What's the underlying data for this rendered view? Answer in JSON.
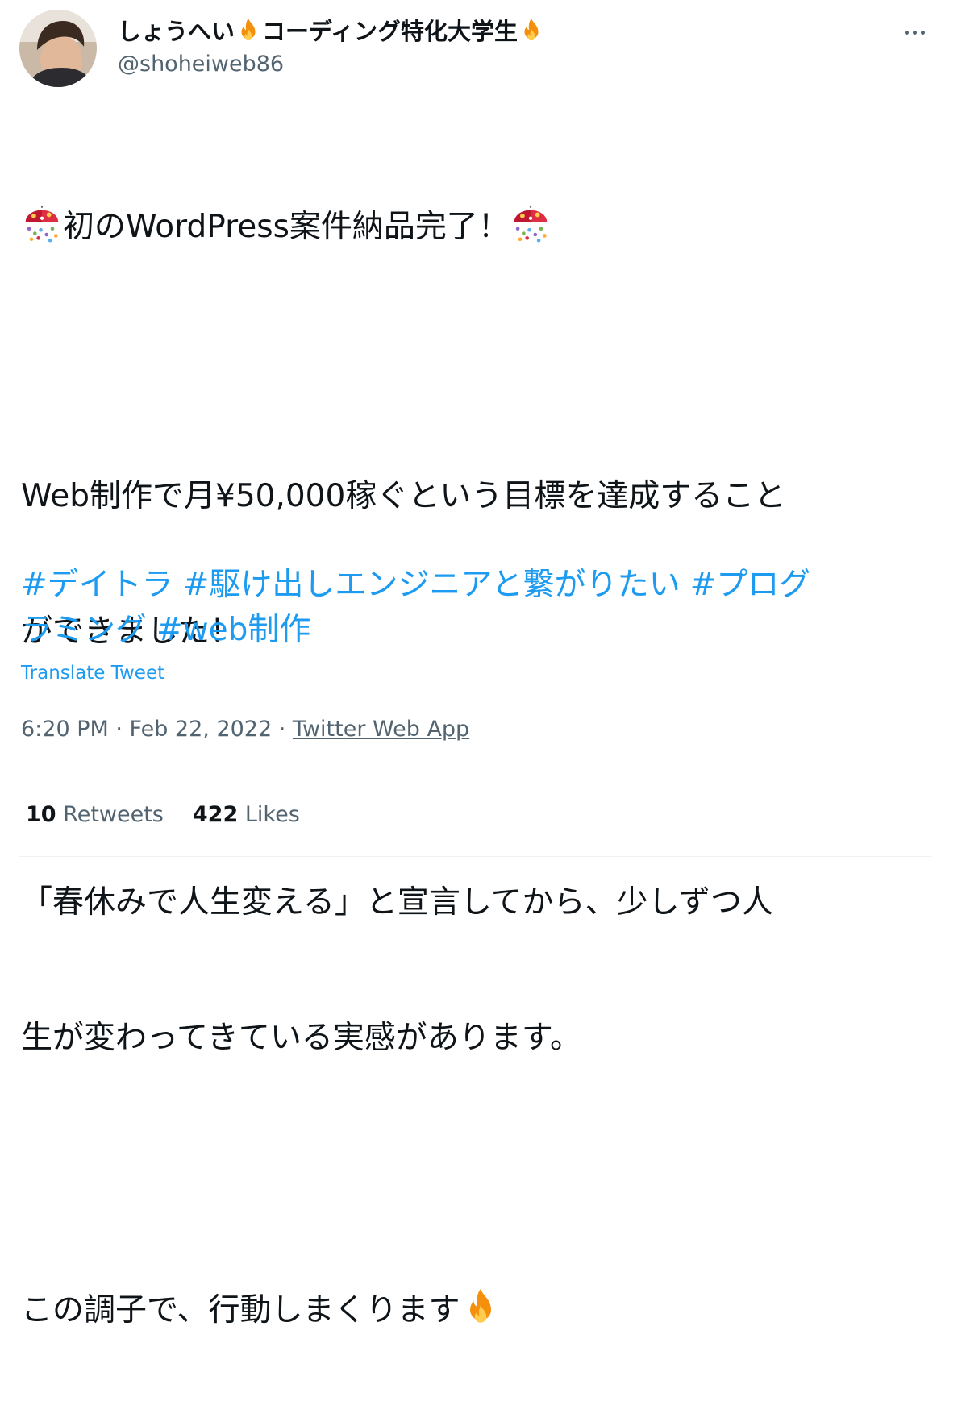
{
  "user": {
    "display_name_part1": "しょうへい",
    "display_name_part2": "コーディング特化大学生",
    "handle": "@shoheiweb86"
  },
  "icons": {
    "menu": "more-horizontal-icon",
    "name_emoji": "fire-icon",
    "celebration": "confetti-ball-icon"
  },
  "tweet": {
    "line1": "初のWordPress案件納品完了！",
    "line2a": "Web制作で月¥50,000稼ぐという目標を達成すること",
    "line2b": "ができました！",
    "line3a": "「春休みで人生変える」と宣言してから、少しずつ人",
    "line3b": "生が変わってきている実感があります。",
    "line4": "この調子で、行動しまくります",
    "hashtags": [
      "#デイトラ",
      "#駆け出しエンジニアと繋がりたい",
      "#プログ",
      "ラミング",
      "#web制作"
    ]
  },
  "translate_label": "Translate Tweet",
  "meta": {
    "time": "6:20 PM",
    "separator": " · ",
    "date": "Feb 22, 2022",
    "source": "Twitter Web App"
  },
  "stats": {
    "retweets_count": "10",
    "retweets_label": "Retweets",
    "likes_count": "422",
    "likes_label": "Likes"
  },
  "colors": {
    "link": "#1d9bf0",
    "secondary_text": "#536471",
    "primary_text": "#0f1419",
    "divider": "#eff3f4"
  }
}
